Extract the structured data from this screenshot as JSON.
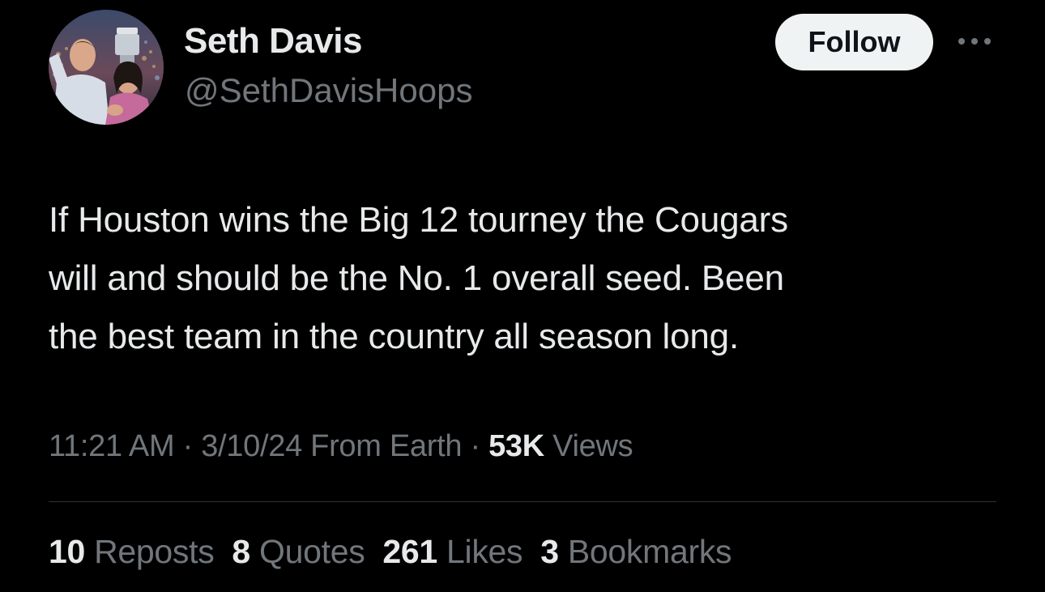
{
  "author": {
    "name": "Seth Davis",
    "handle": "@SethDavisHoops"
  },
  "follow_label": "Follow",
  "more_icon": "more-horizontal-icon",
  "tweet": {
    "lines": [
      "If Houston wins the Big 12 tourney the Cougars",
      "will and should be the No. 1 overall seed. Been",
      "the best team in the country all season long."
    ]
  },
  "meta": {
    "time": "11:21 AM",
    "sep1": " · ",
    "date": "3/10/24",
    "location": " From Earth",
    "sep2": " · ",
    "views_count": "53K",
    "views_label": " Views"
  },
  "stats": [
    {
      "count": "10",
      "label": " Reposts"
    },
    {
      "count": "8",
      "label": " Quotes"
    },
    {
      "count": "261",
      "label": " Likes"
    },
    {
      "count": "3",
      "label": " Bookmarks"
    }
  ],
  "colors": {
    "background": "#000000",
    "primary_text": "#e7e9ea",
    "secondary_text": "#71767b",
    "follow_bg": "#eff3f4",
    "divider": "#2f3336"
  }
}
